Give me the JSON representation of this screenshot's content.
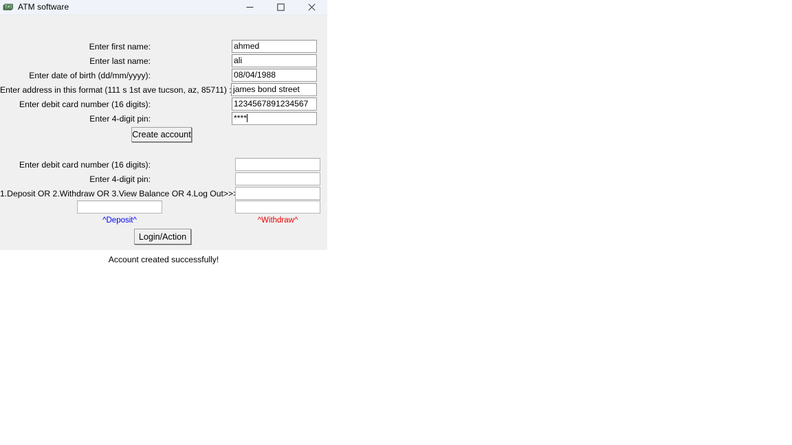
{
  "window": {
    "title": "ATM software",
    "icon": "money-icon",
    "controls": [
      {
        "name": "minimize-button",
        "glyph": "minimize-icon"
      },
      {
        "name": "maximize-button",
        "glyph": "maximize-icon"
      },
      {
        "name": "close-button",
        "glyph": "close-icon"
      }
    ],
    "background_color": "#f0f0f0",
    "titlebar_color": "#f0f3f9"
  },
  "create_account_form": {
    "fields": [
      {
        "label": "Enter first name:",
        "value": "ahmed",
        "placeholder": ""
      },
      {
        "label": "Enter last name:",
        "value": "ali",
        "placeholder": ""
      },
      {
        "label": "Enter date of birth (dd/mm/yyyy):",
        "value": "08/04/1988",
        "placeholder": ""
      },
      {
        "label": "Enter address in this format (111 s 1st ave tucson, az, 85711) :",
        "value": "james bond street",
        "placeholder": ""
      },
      {
        "label": "Enter debit card number (16 digits):",
        "value": "1234567891234567",
        "placeholder": ""
      },
      {
        "label": "Enter 4-digit pin:",
        "value": "****",
        "placeholder": ""
      }
    ],
    "submit_label": "Create account"
  },
  "login_form": {
    "fields": [
      {
        "label": "Enter debit card number (16 digits):",
        "value": "",
        "placeholder": ""
      },
      {
        "label": "Enter 4-digit pin:",
        "value": "",
        "placeholder": ""
      },
      {
        "label": "1.Deposit OR 2.Withdraw OR 3.View Balance OR 4.Log Out>>>",
        "value": "",
        "placeholder": ""
      }
    ],
    "deposit_input": {
      "value": "",
      "placeholder": ""
    },
    "withdraw_input": {
      "value": "",
      "placeholder": ""
    },
    "deposit_label": "^Deposit^",
    "withdraw_label": "^Withdraw^",
    "deposit_color": "#0000ee",
    "withdraw_color": "#ee0000",
    "submit_label": "Login/Action"
  },
  "status": {
    "message": "Account created successfully!"
  }
}
